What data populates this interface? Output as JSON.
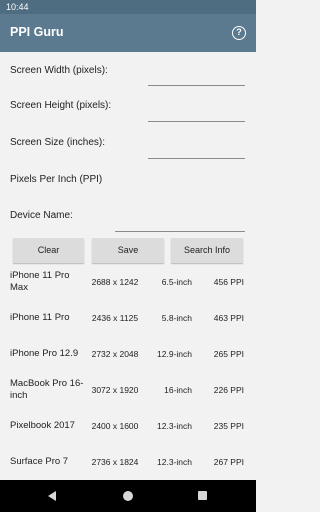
{
  "status_bar": {
    "time": "10:44"
  },
  "app_bar": {
    "title": "PPI Guru",
    "help_icon": "help-circle-icon",
    "help_glyph": "?"
  },
  "form": {
    "width_label": "Screen Width (pixels):",
    "height_label": "Screen Height (pixels):",
    "size_label": "Screen Size (inches):",
    "ppi_label": "Pixels Per Inch (PPI)",
    "device_name_label": "Device Name:",
    "width_value": "",
    "height_value": "",
    "size_value": "",
    "device_name_value": ""
  },
  "buttons": {
    "clear": "Clear",
    "save": "Save",
    "search": "Search Info"
  },
  "devices": [
    {
      "name": "iPhone 11 Pro Max",
      "resolution": "2688 x 1242",
      "size": "6.5-inch",
      "ppi": "456 PPI"
    },
    {
      "name": "iPhone 11 Pro",
      "resolution": "2436 x 1125",
      "size": "5.8-inch",
      "ppi": "463 PPI"
    },
    {
      "name": "iPhone Pro 12.9",
      "resolution": "2732 x 2048",
      "size": "12.9-inch",
      "ppi": "265 PPI"
    },
    {
      "name": "MacBook Pro 16-inch",
      "resolution": "3072 x 1920",
      "size": "16-inch",
      "ppi": "226 PPI"
    },
    {
      "name": "Pixelbook 2017",
      "resolution": "2400 x 1600",
      "size": "12.3-inch",
      "ppi": "235 PPI"
    },
    {
      "name": "Surface Pro 7",
      "resolution": "2736 x 1824",
      "size": "12.3-inch",
      "ppi": "267 PPI"
    }
  ],
  "nav_bar": {
    "back_icon": "back-triangle-icon",
    "home_icon": "home-circle-icon",
    "recents_icon": "recents-square-icon"
  },
  "colors": {
    "app_bar": "#5b7a8f",
    "status_bar": "#4f6d80",
    "button": "#dcdcdc",
    "background": "#f2f2f2"
  }
}
